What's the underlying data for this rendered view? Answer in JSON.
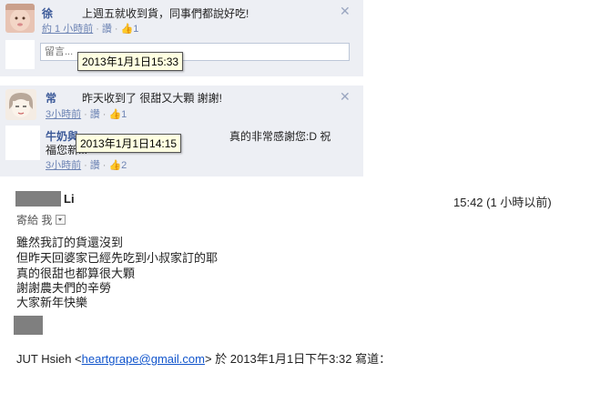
{
  "comments": [
    {
      "author": "徐",
      "text": "上週五就收到貨，同事們都說好吃!",
      "time": "約 1 小時前",
      "like": "讚",
      "like_count": "1"
    },
    {
      "author": "常",
      "text": "昨天收到了 很甜又大顆 謝謝!",
      "time": "3小時前",
      "like": "讚",
      "like_count": "1"
    }
  ],
  "comment_box": {
    "placeholder": "留言..."
  },
  "reply": {
    "author": "牛奶與...",
    "text": "真的非常感謝您:D 祝",
    "text2": "福您新...",
    "time": "3小時前",
    "like": "讚",
    "like_count": "2"
  },
  "tooltips": {
    "first": "2013年1月1日15:33",
    "second": "2013年1月1日14:15"
  },
  "icons": {
    "like": "thumbs-up-icon",
    "close": "close-icon",
    "dropdown": "dropdown-icon"
  },
  "email": {
    "sender_suffix": "Li",
    "time": "15:42 (1 小時以前)",
    "to": "寄給 我",
    "body": [
      "雖然我訂的貨還沒到",
      "但昨天回婆家已經先吃到小叔家訂的耶",
      "真的很甜也都算很大顆",
      "謝謝農夫們的辛勞",
      "大家新年快樂"
    ],
    "quote_prefix": "JUT Hsieh <",
    "quote_email": "heartgrape@gmail.com",
    "quote_suffix": "> 於 2013年1月1日下午3:32 寫道："
  },
  "colors": {
    "fb_bg": "#edeff4",
    "fb_link": "#3b5998",
    "gmail_link": "#1155cc"
  }
}
